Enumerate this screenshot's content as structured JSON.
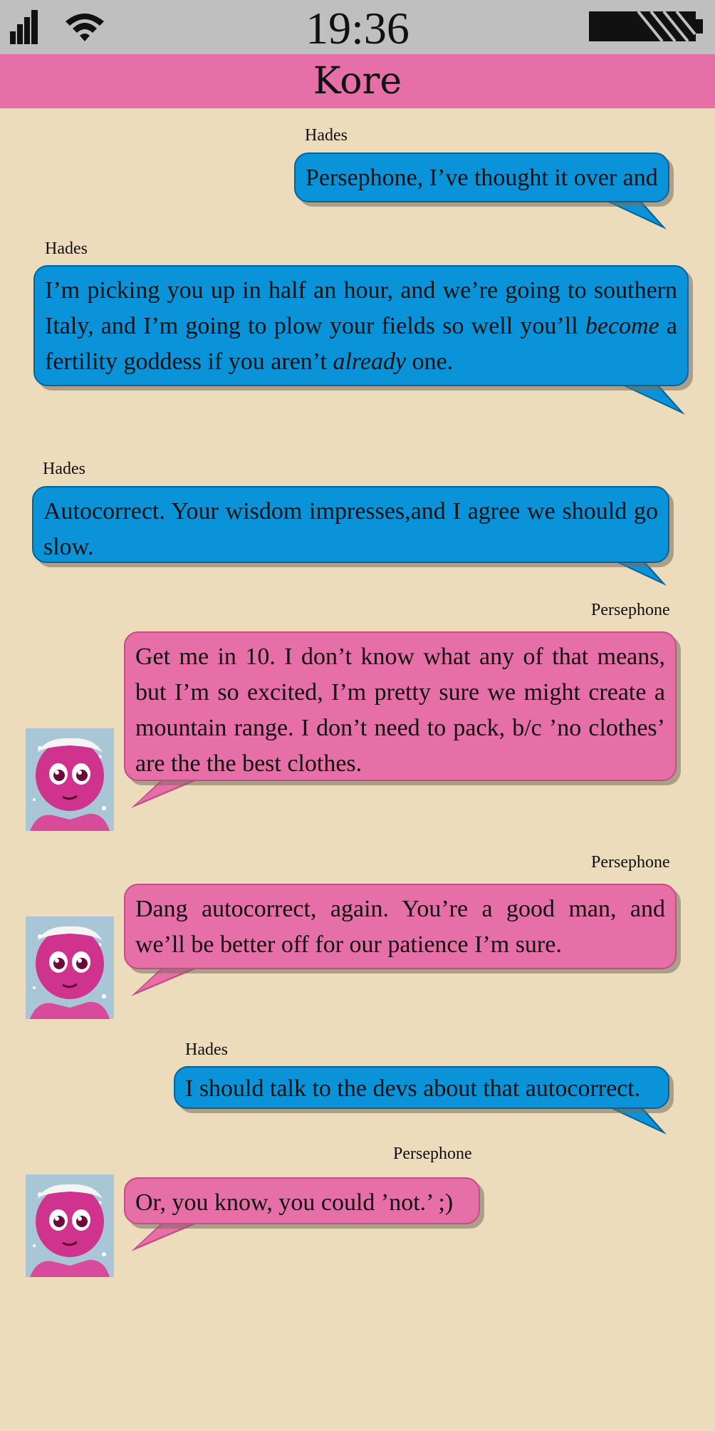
{
  "status_bar": {
    "time": "19:36",
    "icons": [
      "signal-bars-icon",
      "wifi-icon",
      "battery-icon"
    ]
  },
  "header": {
    "title": "Kore"
  },
  "colors": {
    "status_bar_bg": "#bfbfbf",
    "header_bg": "#e56fa6",
    "page_bg": "#ecdcbc",
    "hades_bubble": "#0a93d8",
    "persephone_bubble": "#e56fa6"
  },
  "messages": [
    {
      "sender": "Hades",
      "text": "Persephone, I’ve thought it over and"
    },
    {
      "sender": "Hades",
      "text": "I’m picking you up in half an hour, and we’re going to southern Italy, and I’m going to plow your fields so well you’ll become a fertility goddess if you aren’t already one.",
      "italic_words": [
        "become",
        "already"
      ]
    },
    {
      "sender": "Hades",
      "text": "Autocorrect. Your wisdom impresses,and I agree we should go slow."
    },
    {
      "sender": "Persephone",
      "text": "Get me in 10. I don’t know what any of that means, but I’m so excited, I’m pretty sure we might create a mountain range. I don’t need to pack, b/c ’no clothes’ are the the best clothes."
    },
    {
      "sender": "Persephone",
      "text": "Dang autocorrect, again. You’re a good man, and we’ll be better off for our patience I’m sure."
    },
    {
      "sender": "Hades",
      "text": "I should talk to the devs about that autocorrect."
    },
    {
      "sender": "Persephone",
      "text": "Or, you know, you could ’not.’ ;)"
    }
  ],
  "m2_parts": {
    "a": "I’m picking you up in half an hour, and we’re going to southern Italy, and I’m going to plow your fields so well you’ll ",
    "b": "become",
    "c": " a fertility goddess if you aren’t ",
    "d": "already",
    "e": " one."
  }
}
